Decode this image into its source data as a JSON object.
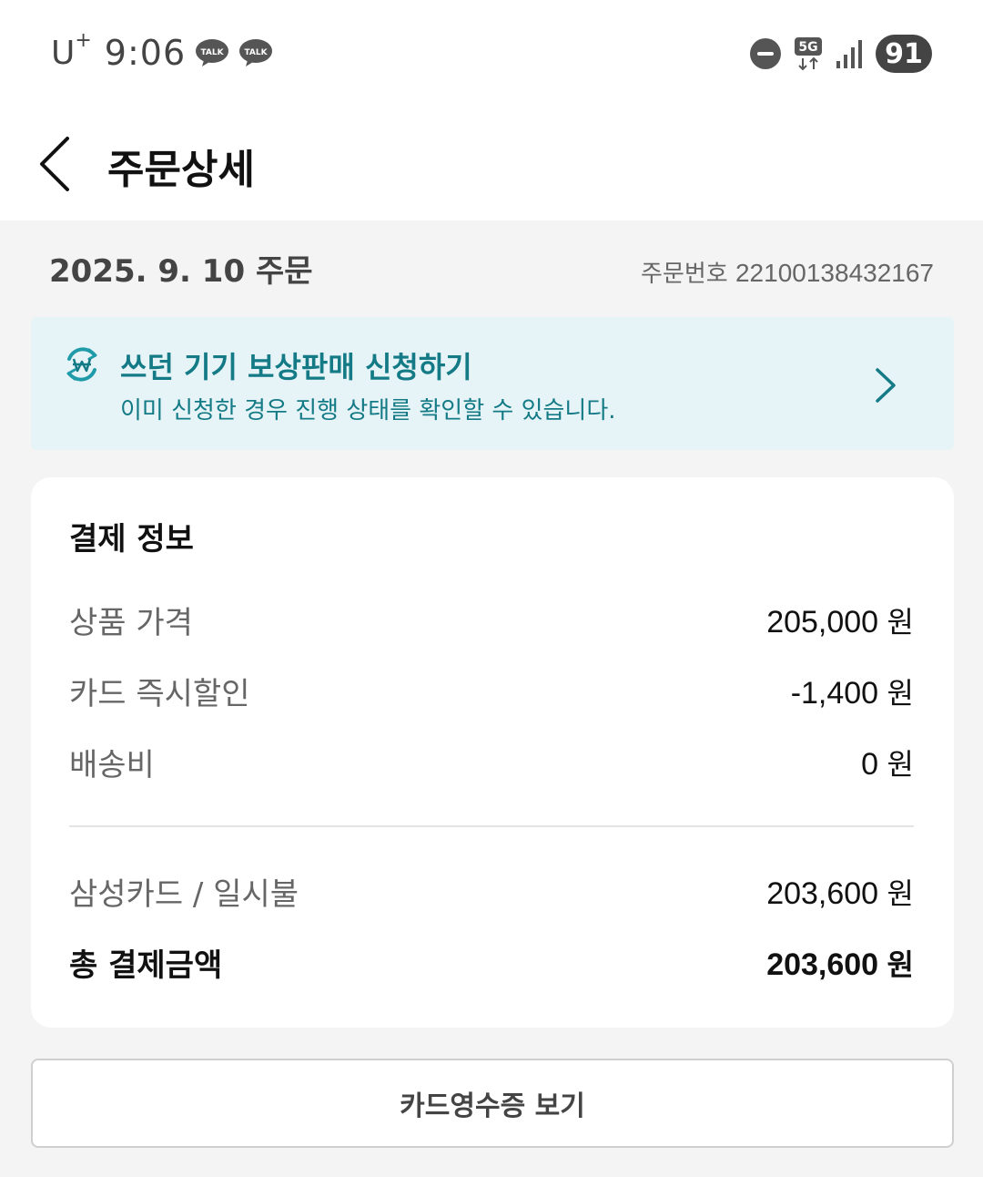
{
  "status_bar": {
    "carrier": "U",
    "carrier_sup": "+",
    "time": "9:06",
    "talk_icon_text": "TALK",
    "network": "5G",
    "battery": "91"
  },
  "header": {
    "title": "주문상세"
  },
  "order": {
    "date": "2025. 9. 10 주문",
    "number_label": "주문번호",
    "number": "22100138432167"
  },
  "banner": {
    "title": "쓰던 기기 보상판매 신청하기",
    "subtitle": "이미 신청한 경우 진행 상태를 확인할 수 있습니다."
  },
  "payment": {
    "title": "결제 정보",
    "currency": "원",
    "rows": [
      {
        "label": "상품 가격",
        "value": "205,000"
      },
      {
        "label": "카드 즉시할인",
        "value": "-1,400"
      },
      {
        "label": "배송비",
        "value": "0"
      }
    ],
    "method": {
      "label": "삼성카드 / 일시불",
      "value": "203,600"
    },
    "total": {
      "label": "총 결제금액",
      "value": "203,600"
    }
  },
  "receipt_button": "카드영수증 보기",
  "colors": {
    "accent_teal": "#137a86",
    "banner_bg": "#e6f4f7",
    "page_bg": "#f4f4f4"
  }
}
